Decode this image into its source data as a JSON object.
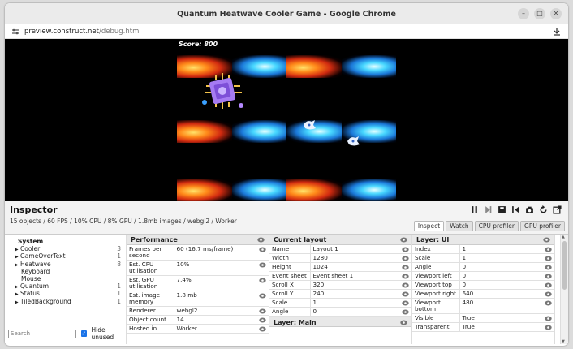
{
  "window": {
    "title": "Quantum Heatwave Cooler Game - Google Chrome",
    "controls": [
      "–",
      "□",
      "✕"
    ]
  },
  "urlbar": {
    "host": "preview.construct.net",
    "path": "/debug.html"
  },
  "game": {
    "score": "Score: 800"
  },
  "inspector": {
    "title": "Inspector",
    "stats": "15 objects / 60 FPS / 10% CPU / 8% GPU / 1.8mb images / webgl2 / Worker",
    "tabs": [
      "Inspect",
      "Watch",
      "CPU profiler",
      "GPU profiler"
    ],
    "active_tab": "Inspect",
    "tools": [
      "pause-icon",
      "step-icon",
      "save-icon",
      "restart-icon",
      "camera-icon",
      "reload-icon",
      "popout-icon"
    ]
  },
  "tree": {
    "items": [
      {
        "label": "System",
        "count": "",
        "kind": "root"
      },
      {
        "label": "Cooler",
        "count": "3",
        "kind": "expand"
      },
      {
        "label": "GameOverText",
        "count": "1",
        "kind": "expand"
      },
      {
        "label": "Heatwave",
        "count": "8",
        "kind": "expand"
      },
      {
        "label": "Keyboard",
        "count": "",
        "kind": "leaf"
      },
      {
        "label": "Mouse",
        "count": "",
        "kind": "leaf"
      },
      {
        "label": "Quantum",
        "count": "1",
        "kind": "expand"
      },
      {
        "label": "Status",
        "count": "1",
        "kind": "expand"
      },
      {
        "label": "TiledBackground",
        "count": "1",
        "kind": "expand"
      }
    ],
    "search_placeholder": "Search",
    "hide_unused_label": "Hide unused",
    "hide_unused_checked": true
  },
  "performance": {
    "title": "Performance",
    "rows": [
      {
        "k": "Frames per second",
        "v": "60 (16.7 ms/frame)"
      },
      {
        "k": "Est. CPU utilisation",
        "v": "10%"
      },
      {
        "k": "Est. GPU utilisation",
        "v": "7.4%"
      },
      {
        "k": "Est. image memory",
        "v": "1.8 mb"
      },
      {
        "k": "Renderer",
        "v": "webgl2"
      },
      {
        "k": "Object count",
        "v": "14"
      },
      {
        "k": "Hosted in",
        "v": "Worker"
      }
    ]
  },
  "layout": {
    "title": "Current layout",
    "rows": [
      {
        "k": "Name",
        "v": "Layout 1"
      },
      {
        "k": "Width",
        "v": "1280"
      },
      {
        "k": "Height",
        "v": "1024"
      },
      {
        "k": "Event sheet",
        "v": "Event sheet 1"
      },
      {
        "k": "Scroll X",
        "v": "320"
      },
      {
        "k": "Scroll Y",
        "v": "240"
      },
      {
        "k": "Scale",
        "v": "1"
      },
      {
        "k": "Angle",
        "v": "0"
      }
    ],
    "sub_title": "Layer: Main"
  },
  "layer_ui": {
    "title": "Layer: UI",
    "rows": [
      {
        "k": "Index",
        "v": "1"
      },
      {
        "k": "Scale",
        "v": "1"
      },
      {
        "k": "Angle",
        "v": "0"
      },
      {
        "k": "Viewport left",
        "v": "0"
      },
      {
        "k": "Viewport top",
        "v": "0"
      },
      {
        "k": "Viewport right",
        "v": "640"
      },
      {
        "k": "Viewport bottom",
        "v": "480"
      },
      {
        "k": "Visible",
        "v": "True"
      },
      {
        "k": "Transparent",
        "v": "True"
      }
    ]
  }
}
